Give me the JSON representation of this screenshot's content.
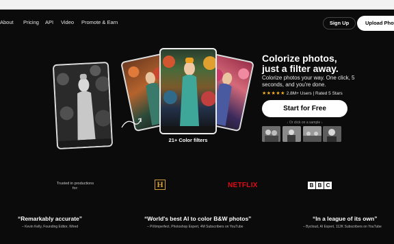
{
  "nav": {
    "links": [
      "About",
      "Pricing",
      "API",
      "Video",
      "Promote & Earn"
    ],
    "signup_label": "Sign Up",
    "upload_label": "Upload Photo"
  },
  "hero": {
    "title_line1": "Colorize photos,",
    "title_line2": "just a filter away.",
    "subtitle": "Colorize photos your way. One click, 5 seconds, and you're done.",
    "stars": "★★★★★",
    "rating_text": "2.8M+ Users | Rated 5 Stars",
    "cta_label": "Start for Free",
    "sample_hint": "↓ Or click on a sample ↓",
    "filters_label": "21+ Color filters"
  },
  "trusted": {
    "label": "Trusted in productions for:",
    "logos": [
      "history-logo",
      "netflix-logo",
      "bbc-logo"
    ],
    "netflix_text": "NETFLIX",
    "history_text": "H",
    "bbc_letters": [
      "B",
      "B",
      "C"
    ]
  },
  "testimonials": [
    {
      "quote": "“Remarkably accurate”",
      "attribution": "– Kevin Kelly, Founding Editor, Wired"
    },
    {
      "quote": "“World's best AI to color B&W photos”",
      "attribution": "– PiXimperfect, Photoshop Expert, 4M Subscribers on YouTube"
    },
    {
      "quote": "“In a league of its own”",
      "attribution": "– Bycloud, AI Expert, 112K Subscribers on YouTube"
    }
  ],
  "colors": {
    "background": "#0b0b0b",
    "star": "#f5b324",
    "netflix": "#e50914",
    "history": "#d8a23a"
  }
}
